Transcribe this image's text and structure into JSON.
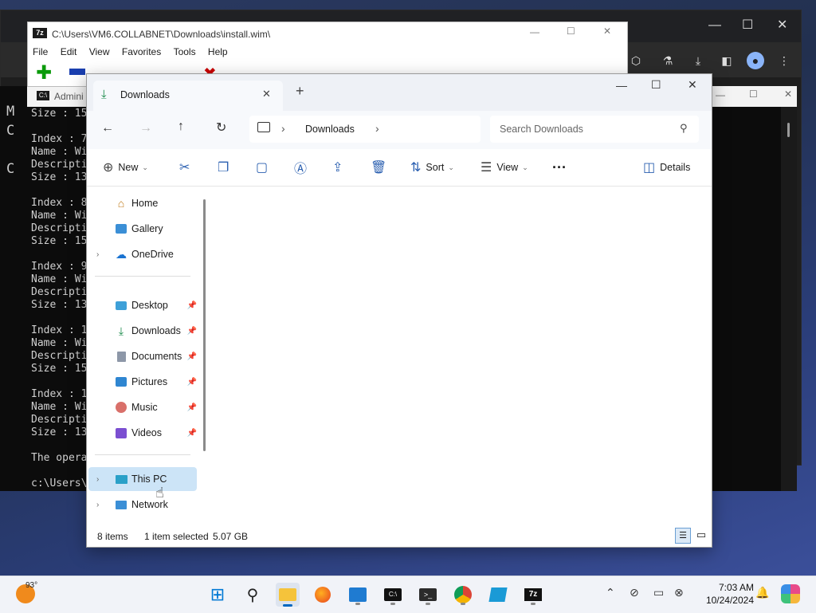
{
  "chrome": {
    "tab_label": ""
  },
  "zip": {
    "title": "C:\\Users\\VM6.COLLABNET\\Downloads\\install.wim\\",
    "menu": [
      "File",
      "Edit",
      "View",
      "Favorites",
      "Tools",
      "Help"
    ]
  },
  "cmd": {
    "title": "Admini",
    "lines": "Size : 15\n\nIndex : 7\nName : Wi\nDescripti\nSize : 13\n\nIndex : 8\nName : Wi\nDescripti\nSize : 15\n\nIndex : 9\nName : Wi\nDescripti\nSize : 13\n\nIndex : 1\nName : Wi\nDescripti\nSize : 15\n\nIndex : 1\nName : Wi\nDescripti\nSize : 13\n\nThe opera\n\nc:\\Users\\",
    "left_lines": "M\nC\n\nC"
  },
  "explorer": {
    "tab_title": "Downloads",
    "breadcrumb": "Downloads",
    "search_placeholder": "Search Downloads",
    "cmd": {
      "new": "New",
      "sort": "Sort",
      "view": "View",
      "details": "Details"
    },
    "nav": {
      "home": "Home",
      "gallery": "Gallery",
      "onedrive": "OneDrive",
      "desktop": "Desktop",
      "downloads": "Downloads",
      "documents": "Documents",
      "pictures": "Pictures",
      "music": "Music",
      "videos": "Videos",
      "thispc": "This PC",
      "network": "Network"
    },
    "status": {
      "items": "8 items",
      "selected": "1 item selected",
      "size": "5.07 GB"
    }
  },
  "taskbar": {
    "weather": "93°",
    "time": "7:03 AM",
    "date": "10/24/2024"
  },
  "colors": {
    "accent": "#0067c0",
    "selected_nav": "#cce4f7"
  }
}
